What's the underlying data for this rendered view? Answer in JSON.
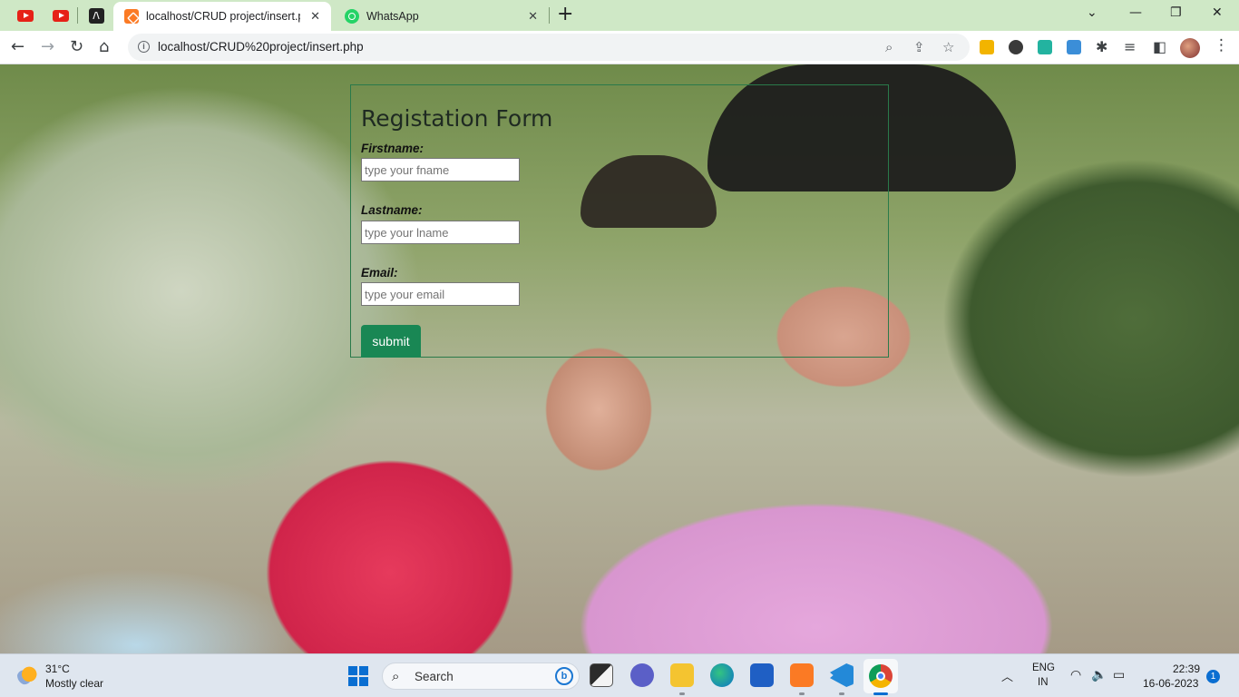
{
  "browser": {
    "tabs": [
      {
        "title": "localhost/CRUD project/insert.php",
        "active": true,
        "icon": "xampp-icon"
      },
      {
        "title": "WhatsApp",
        "active": false,
        "icon": "whatsapp-icon"
      }
    ],
    "pinned_icons": [
      "youtube-icon",
      "youtube-icon",
      "codepen-icon"
    ],
    "address": "localhost/CRUD%20project/insert.php"
  },
  "form": {
    "title": "Registation Form",
    "firstname_label": "Firstname:",
    "firstname_placeholder": "type your fname",
    "lastname_label": "Lastname:",
    "lastname_placeholder": "type your lname",
    "email_label": "Email:",
    "email_placeholder": "type your email",
    "submit_label": "submit",
    "border_color": "#2a7a4a",
    "button_color": "#198754"
  },
  "taskbar": {
    "weather_temp": "31°C",
    "weather_desc": "Mostly clear",
    "search_label": "Search",
    "lang_line1": "ENG",
    "lang_line2": "IN",
    "time": "22:39",
    "date": "16-06-2023",
    "notification_count": "1"
  }
}
